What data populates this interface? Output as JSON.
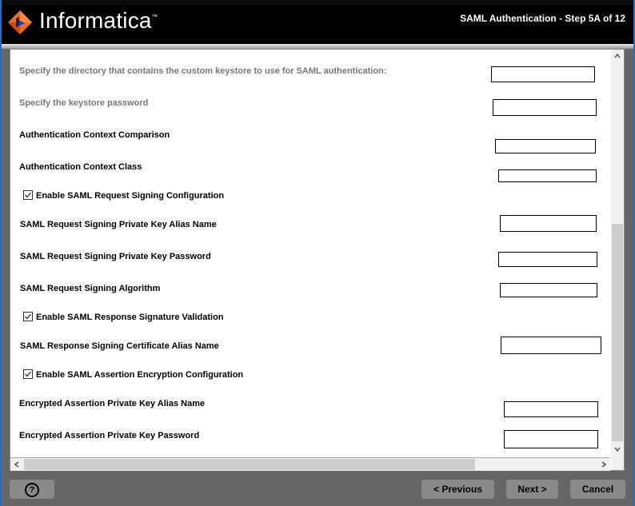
{
  "header": {
    "brand": "Informatica",
    "trademark": "™",
    "step_title": "SAML Authentication - Step 5A of 12",
    "logo_icon": "informatica-diamond-logo"
  },
  "form": {
    "keystore_dir_label": "Specify the directory that contains the custom keystore to use for SAML authentication:",
    "keystore_dir_value": "",
    "keystore_password_label": "Specify the keystore password",
    "keystore_password_value": "",
    "auth_context_comparison_label": "Authentication Context Comparison",
    "auth_context_comparison_value": "",
    "auth_context_class_label": "Authentication Context Class",
    "auth_context_class_value": "",
    "enable_request_signing": {
      "label": "Enable SAML Request Signing Configuration",
      "checked": true
    },
    "request_key_alias_label": "SAML Request Signing Private Key Alias Name",
    "request_key_alias_value": "",
    "request_key_password_label": "SAML Request Signing Private Key Password",
    "request_key_password_value": "",
    "request_algorithm_label": "SAML Request Signing Algorithm",
    "request_algorithm_value": "",
    "enable_response_validation": {
      "label": "Enable SAML Response Signature Validation",
      "checked": true
    },
    "response_cert_alias_label": "SAML Response Signing Certificate Alias Name",
    "response_cert_alias_value": "",
    "enable_assertion_encryption": {
      "label": "Enable SAML Assertion Encryption Configuration",
      "checked": true
    },
    "assertion_key_alias_label": "Encrypted Assertion Private Key Alias Name",
    "assertion_key_alias_value": "",
    "assertion_key_password_label": "Encrypted Assertion Private Key Password",
    "assertion_key_password_value": ""
  },
  "scroll": {
    "up_arrow": "▲",
    "down_arrow": "▼",
    "left_arrow": "<",
    "right_arrow": ">"
  },
  "footer": {
    "help_symbol": "?",
    "previous_label": "< Previous",
    "next_label": "Next >",
    "cancel_label": "Cancel"
  }
}
